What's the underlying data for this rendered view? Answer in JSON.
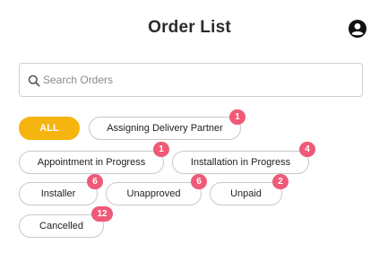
{
  "header": {
    "title": "Order List",
    "profile_icon": "account-circle-icon"
  },
  "search": {
    "icon": "search-icon",
    "placeholder": "Search Orders",
    "value": ""
  },
  "filters": {
    "selected": "ALL",
    "active_color": "#f6b40e",
    "badge_color": "#ee5a77",
    "items": [
      {
        "label": "ALL",
        "count": null
      },
      {
        "label": "Assigning Delivery Partner",
        "count": "1"
      },
      {
        "label": "Appointment in Progress",
        "count": "1"
      },
      {
        "label": "Installation in Progress",
        "count": "4"
      },
      {
        "label": "Installer",
        "count": "6"
      },
      {
        "label": "Unapproved",
        "count": "6"
      },
      {
        "label": "Unpaid",
        "count": "2"
      },
      {
        "label": "Cancelled",
        "count": "12"
      }
    ]
  }
}
